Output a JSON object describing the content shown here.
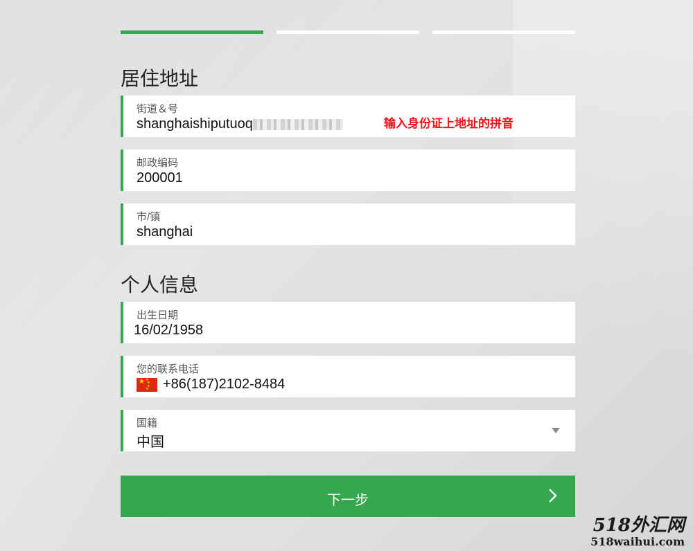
{
  "progress": {
    "steps": 3,
    "active_step": 1
  },
  "address_section": {
    "title": "居住地址",
    "street": {
      "label": "街道＆号",
      "value": "shanghaishiputuoq",
      "hint": "输入身份证上地址的拼音"
    },
    "postcode": {
      "label": "邮政编码",
      "value": "200001"
    },
    "city": {
      "label": "市/镇",
      "value": "shanghai"
    }
  },
  "personal_section": {
    "title": "个人信息",
    "birthdate": {
      "label": "出生日期",
      "value": "16/02/1958"
    },
    "phone": {
      "label": "您的联系电话",
      "value": "+86(187)2102-8484",
      "flag_icon": "china-flag-icon"
    },
    "nationality": {
      "label": "国籍",
      "value": "中国",
      "icon": "dropdown-caret-icon"
    }
  },
  "next_button": {
    "label": "下一步",
    "icon": "chevron-right-icon"
  },
  "watermark": {
    "logo": "518外汇网",
    "url": "518waihui.com"
  },
  "colors": {
    "accent": "#35a84e",
    "hint": "#e8141a",
    "field_bg": "#ffffff"
  }
}
